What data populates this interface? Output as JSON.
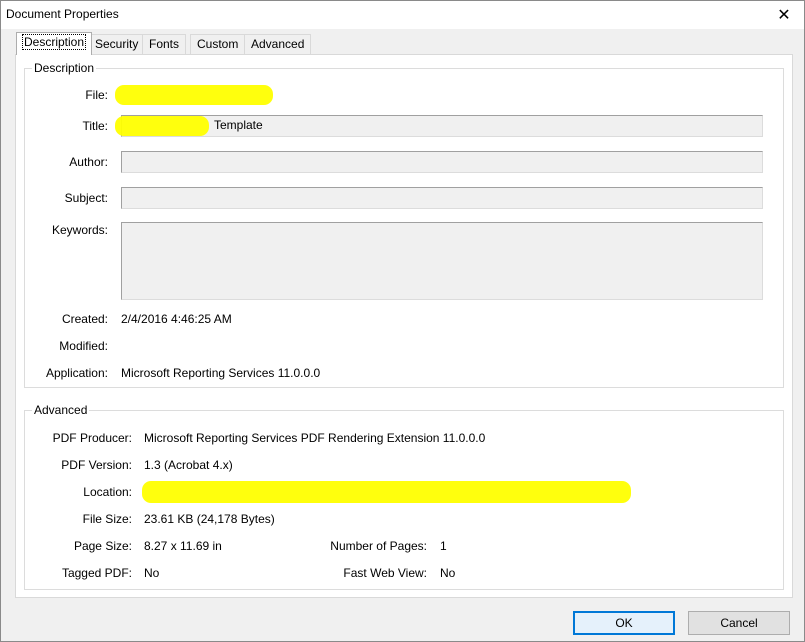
{
  "window": {
    "title": "Document Properties",
    "close_glyph": "✕"
  },
  "tabs": [
    "Description",
    "Security",
    "Fonts",
    "Custom",
    "Advanced"
  ],
  "description": {
    "group_title": "Description",
    "labels": {
      "file": "File:",
      "title": "Title:",
      "author": "Author:",
      "subject": "Subject:",
      "keywords": "Keywords:",
      "created": "Created:",
      "modified": "Modified:",
      "application": "Application:"
    },
    "values": {
      "file": "",
      "title": "Template",
      "author": "",
      "subject": "",
      "keywords": "",
      "created": "2/4/2016 4:46:25 AM",
      "modified": "",
      "application": "Microsoft Reporting Services 11.0.0.0"
    }
  },
  "advanced": {
    "group_title": "Advanced",
    "labels": {
      "pdf_producer": "PDF Producer:",
      "pdf_version": "PDF Version:",
      "location": "Location:",
      "file_size": "File Size:",
      "page_size": "Page Size:",
      "number_of_pages": "Number of Pages:",
      "tagged_pdf": "Tagged PDF:",
      "fast_web_view": "Fast Web View:"
    },
    "values": {
      "pdf_producer": "Microsoft Reporting Services PDF Rendering Extension 11.0.0.0",
      "pdf_version": "1.3 (Acrobat 4.x)",
      "location": "",
      "file_size": "23.61 KB (24,178 Bytes)",
      "page_size": "8.27 x 11.69 in",
      "number_of_pages": "1",
      "tagged_pdf": "No",
      "fast_web_view": "No"
    }
  },
  "buttons": {
    "ok": "OK",
    "cancel": "Cancel"
  },
  "colors": {
    "redaction": "#ffff00",
    "accent": "#0078d7"
  }
}
